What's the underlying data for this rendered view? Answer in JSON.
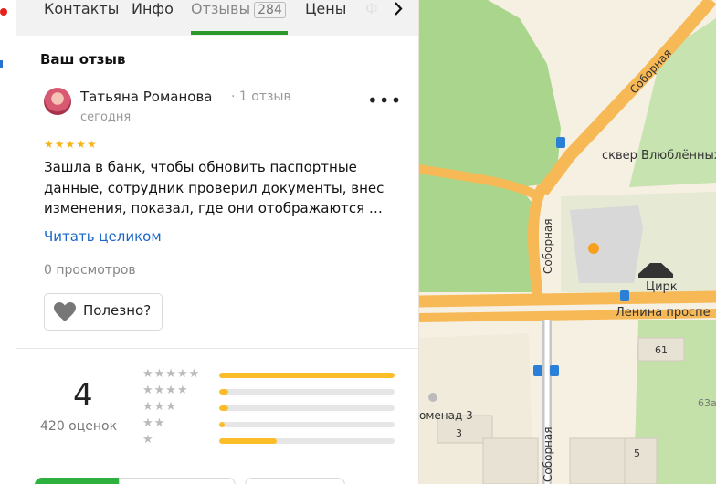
{
  "tabs": {
    "items": [
      "Контакты",
      "Инфо",
      "Отзывы",
      "Цены",
      "Ф"
    ],
    "active_count": "284"
  },
  "review_section_title": "Ваш отзыв",
  "review": {
    "author": "Татьяна Романова",
    "author_reviews": "1 отзыв",
    "date": "сегодня",
    "stars": 5,
    "text": "Зашла в банк, чтобы обновить паспортные данные, сотрудник проверил документы, внес изменения, показал, где они отображаются …",
    "read_more": "Читать целиком",
    "views": "0 просмотров",
    "useful_label": "Полезно?"
  },
  "rating": {
    "value": "4",
    "count": "420 оценок",
    "distribution": [
      {
        "stars": 5,
        "fraction": 1.0
      },
      {
        "stars": 4,
        "fraction": 0.05
      },
      {
        "stars": 3,
        "fraction": 0.05
      },
      {
        "stars": 2,
        "fraction": 0.03
      },
      {
        "stars": 1,
        "fraction": 0.33
      }
    ]
  },
  "map": {
    "labels": {
      "sobornaya_top": "Соборная",
      "square": "сквер Влюблённых",
      "sobornaya_mid": "Соборная",
      "circus": "Цирк",
      "lenina": "Ленина проспе",
      "house_61": "61",
      "house_63a": "63а",
      "promenad": "оменад 3",
      "house_3": "3",
      "house_5": "5",
      "sobornaya_bottom": "Соборная"
    }
  },
  "colors": {
    "accent_green": "#2b9a2b",
    "link_blue": "#1a66c8",
    "star_yellow": "#f5b51b",
    "road_orange": "#f7b955",
    "park_green": "#a9d68c"
  }
}
